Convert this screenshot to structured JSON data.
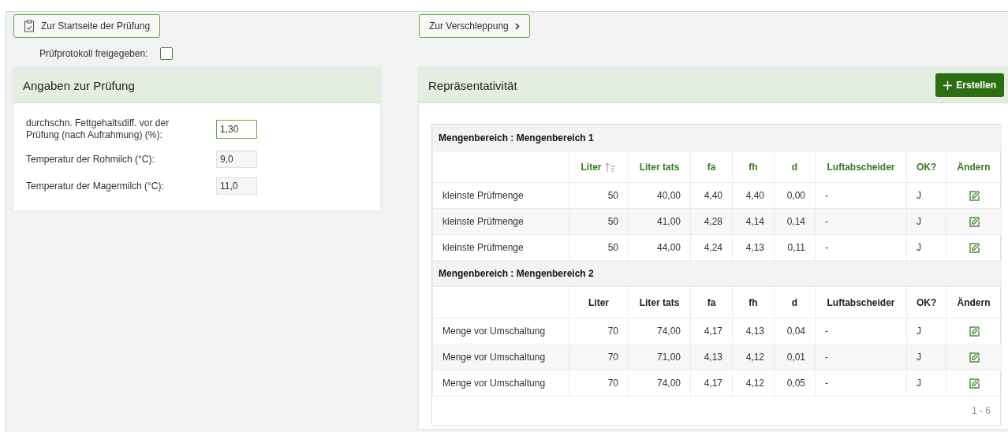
{
  "toolbar": {
    "start_button": "Zur Startseite der Prüfung",
    "next_button": "Zur Verschleppung",
    "released": {
      "label": "Prüfprotokoll freigegeben:",
      "checked": false
    }
  },
  "details_panel": {
    "title": "Angaben zur Prüfung",
    "fields": [
      {
        "label": "durchschn. Fettgehaltsdiff. vor der Prüfung (nach Aufrahmung) (%):",
        "value": "1,30",
        "focused": true
      },
      {
        "label": "Temperatur der Rohmilch (°C):",
        "value": "9,0",
        "focused": false
      },
      {
        "label": "Temperatur der Magermilch (°C):",
        "value": "11,0",
        "focused": false
      }
    ]
  },
  "representativeness_panel": {
    "title": "Repräsentativität",
    "create_button": "Erstellen",
    "groups": [
      {
        "title": "Mengenbereich : Mengenbereich 1",
        "highlighted": true,
        "columns": [
          {
            "sorted": false
          },
          {
            "label": "Liter",
            "sorted": true
          },
          {
            "label": "Liter tats",
            "sorted": false
          },
          {
            "label": "fa",
            "sorted": false
          },
          {
            "label": "fh",
            "sorted": false
          },
          {
            "label": "d",
            "sorted": false
          },
          {
            "label": "Luftabscheider",
            "sorted": false
          },
          {
            "label": "OK?",
            "sorted": false
          },
          {
            "label": "Ändern",
            "sorted": false
          }
        ],
        "rows": [
          [
            "kleinste Prüfmenge",
            "50",
            "40,00",
            "4,40",
            "4,40",
            "0,00",
            "-",
            "J"
          ],
          [
            "kleinste Prüfmenge",
            "50",
            "41,00",
            "4,28",
            "4,14",
            "0,14",
            "-",
            "J"
          ],
          [
            "kleinste Prüfmenge",
            "50",
            "44,00",
            "4,24",
            "4,13",
            "0,11",
            "-",
            "J"
          ]
        ]
      },
      {
        "title": "Mengenbereich : Mengenbereich 2",
        "highlighted": false,
        "columns": [
          {
            "sorted": false
          },
          {
            "label": "Liter",
            "sorted": false
          },
          {
            "label": "Liter tats",
            "sorted": false
          },
          {
            "label": "fa",
            "sorted": false
          },
          {
            "label": "fh",
            "sorted": false
          },
          {
            "label": "d",
            "sorted": false
          },
          {
            "label": "Luftabscheider",
            "sorted": false
          },
          {
            "label": "OK?",
            "sorted": false
          },
          {
            "label": "Ändern",
            "sorted": false
          }
        ],
        "rows": [
          [
            "Menge vor Umschaltung",
            "70",
            "74,00",
            "4,17",
            "4,13",
            "0,04",
            "-",
            "J"
          ],
          [
            "Menge vor Umschaltung",
            "70",
            "71,00",
            "4,13",
            "4,12",
            "0,01",
            "-",
            "J"
          ],
          [
            "Menge vor Umschaltung",
            "70",
            "74,00",
            "4,17",
            "4,12",
            "0,05",
            "-",
            "J"
          ]
        ]
      }
    ],
    "pager": "1 - 6"
  }
}
